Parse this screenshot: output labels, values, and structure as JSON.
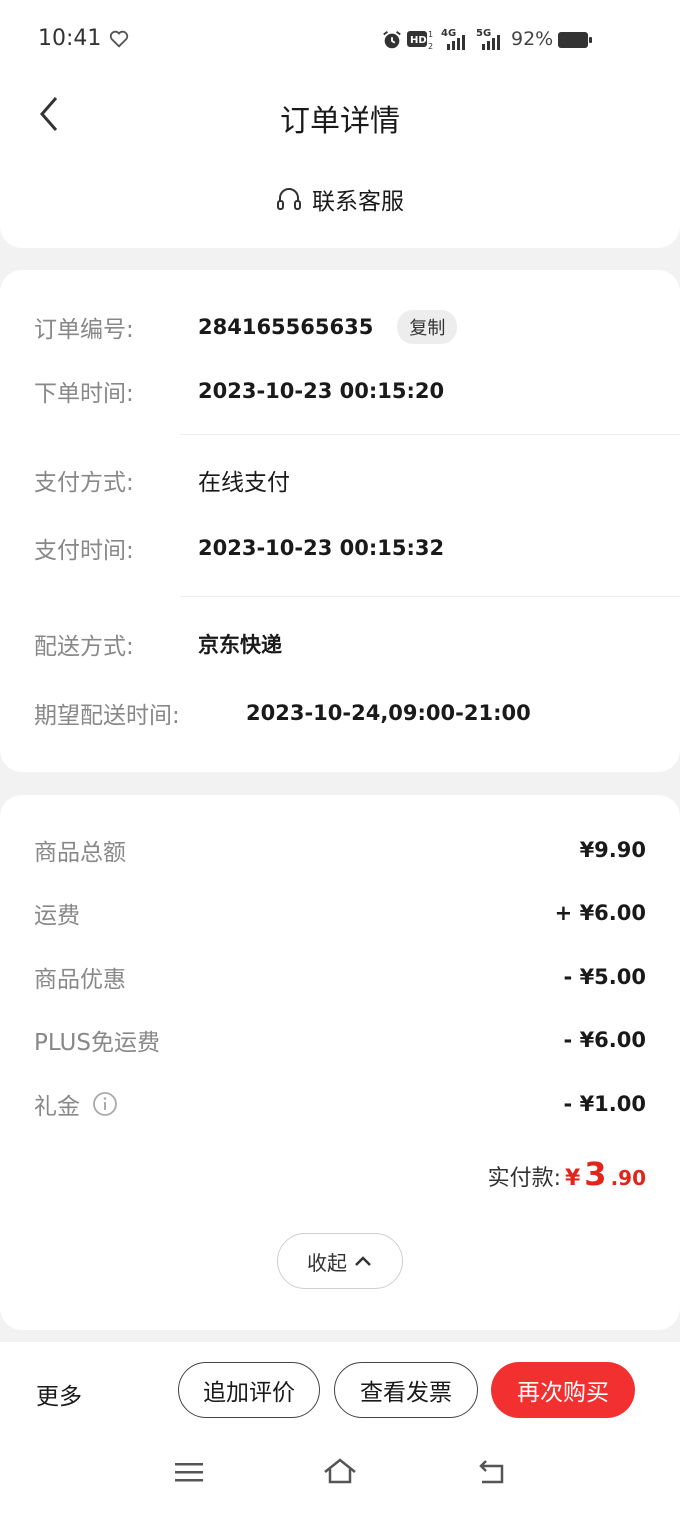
{
  "status_bar": {
    "time": "10:41",
    "battery_percent": "92%",
    "icons": [
      "heart-icon",
      "alarm-icon",
      "hd-icon",
      "signal-4g-icon",
      "signal-5g-icon",
      "battery-icon"
    ]
  },
  "nav": {
    "title": "订单详情"
  },
  "service": {
    "label": "联系客服",
    "icon": "headset-icon"
  },
  "order_info": {
    "order_no_label": "订单编号:",
    "order_no": "284165565635",
    "copy_label": "复制",
    "order_time_label": "下单时间:",
    "order_time": "2023-10-23 00:15:20",
    "pay_method_label": "支付方式:",
    "pay_method": "在线支付",
    "pay_time_label": "支付时间:",
    "pay_time": "2023-10-23 00:15:32",
    "delivery_method_label": "配送方式:",
    "delivery_method": "京东快递",
    "expected_time_label": "期望配送时间:",
    "expected_time": "2023-10-24,09:00-21:00"
  },
  "price": {
    "rows": [
      {
        "label": "商品总额",
        "value": "¥9.90"
      },
      {
        "label": "运费",
        "value": "+ ¥6.00"
      },
      {
        "label": "商品优惠",
        "value": "- ¥5.00"
      },
      {
        "label": "PLUS免运费",
        "value": "- ¥6.00"
      },
      {
        "label": "礼金",
        "value": "- ¥1.00"
      }
    ],
    "total_label": "实付款:",
    "total_currency": "¥",
    "total_int": "3",
    "total_dec": ".90",
    "collapse_label": "收起"
  },
  "bottom": {
    "more_label": "更多",
    "add_review_label": "追加评价",
    "view_invoice_label": "查看发票",
    "buy_again_label": "再次购买"
  },
  "colors": {
    "accent": "#e1251b",
    "primary_button": "#f23030"
  }
}
